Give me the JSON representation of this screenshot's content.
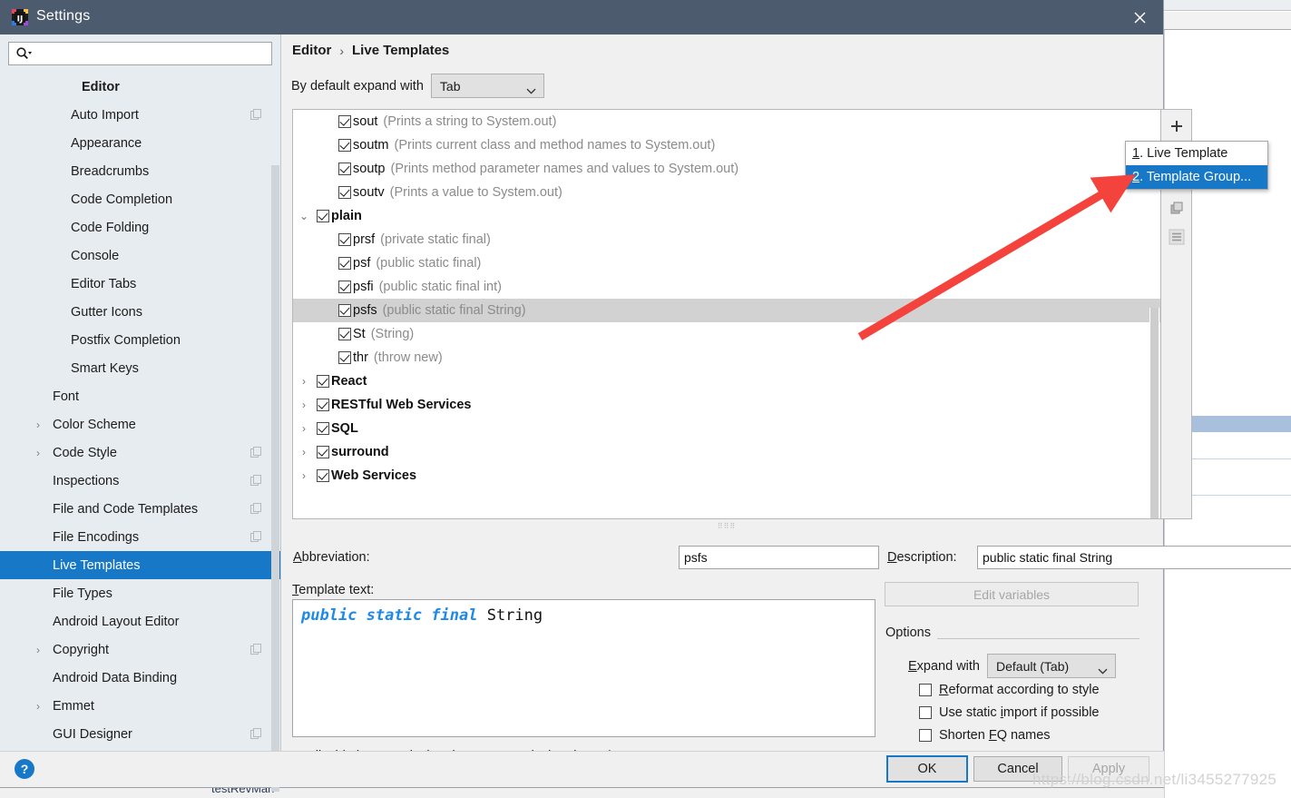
{
  "window": {
    "title": "Settings",
    "app_icon": "intellij-idea-logo-icon",
    "close_icon": "close-icon"
  },
  "sidebar": {
    "search": {
      "placeholder": "",
      "value": "",
      "icon": "search-icon"
    },
    "items": [
      {
        "label": "Editor",
        "level": 0,
        "bold": true,
        "arrow": "",
        "config_icon": false,
        "selected": false
      },
      {
        "label": "Auto Import",
        "level": 2,
        "bold": false,
        "arrow": "",
        "config_icon": true,
        "selected": false
      },
      {
        "label": "Appearance",
        "level": 2,
        "bold": false,
        "arrow": "",
        "config_icon": false,
        "selected": false
      },
      {
        "label": "Breadcrumbs",
        "level": 2,
        "bold": false,
        "arrow": "",
        "config_icon": false,
        "selected": false
      },
      {
        "label": "Code Completion",
        "level": 2,
        "bold": false,
        "arrow": "",
        "config_icon": false,
        "selected": false
      },
      {
        "label": "Code Folding",
        "level": 2,
        "bold": false,
        "arrow": "",
        "config_icon": false,
        "selected": false
      },
      {
        "label": "Console",
        "level": 2,
        "bold": false,
        "arrow": "",
        "config_icon": false,
        "selected": false
      },
      {
        "label": "Editor Tabs",
        "level": 2,
        "bold": false,
        "arrow": "",
        "config_icon": false,
        "selected": false
      },
      {
        "label": "Gutter Icons",
        "level": 2,
        "bold": false,
        "arrow": "",
        "config_icon": false,
        "selected": false
      },
      {
        "label": "Postfix Completion",
        "level": 2,
        "bold": false,
        "arrow": "",
        "config_icon": false,
        "selected": false
      },
      {
        "label": "Smart Keys",
        "level": 2,
        "bold": false,
        "arrow": "",
        "config_icon": false,
        "selected": false
      },
      {
        "label": "Font",
        "level": 1,
        "bold": false,
        "arrow": "",
        "config_icon": false,
        "selected": false
      },
      {
        "label": "Color Scheme",
        "level": 1,
        "bold": false,
        "arrow": "›",
        "config_icon": false,
        "selected": false
      },
      {
        "label": "Code Style",
        "level": 1,
        "bold": false,
        "arrow": "›",
        "config_icon": true,
        "selected": false
      },
      {
        "label": "Inspections",
        "level": 1,
        "bold": false,
        "arrow": "",
        "config_icon": true,
        "selected": false
      },
      {
        "label": "File and Code Templates",
        "level": 1,
        "bold": false,
        "arrow": "",
        "config_icon": true,
        "selected": false
      },
      {
        "label": "File Encodings",
        "level": 1,
        "bold": false,
        "arrow": "",
        "config_icon": true,
        "selected": false
      },
      {
        "label": "Live Templates",
        "level": 1,
        "bold": false,
        "arrow": "",
        "config_icon": false,
        "selected": true
      },
      {
        "label": "File Types",
        "level": 1,
        "bold": false,
        "arrow": "",
        "config_icon": false,
        "selected": false
      },
      {
        "label": "Android Layout Editor",
        "level": 1,
        "bold": false,
        "arrow": "",
        "config_icon": false,
        "selected": false
      },
      {
        "label": "Copyright",
        "level": 1,
        "bold": false,
        "arrow": "›",
        "config_icon": true,
        "selected": false
      },
      {
        "label": "Android Data Binding",
        "level": 1,
        "bold": false,
        "arrow": "",
        "config_icon": false,
        "selected": false
      },
      {
        "label": "Emmet",
        "level": 1,
        "bold": false,
        "arrow": "›",
        "config_icon": false,
        "selected": false
      },
      {
        "label": "GUI Designer",
        "level": 1,
        "bold": false,
        "arrow": "",
        "config_icon": true,
        "selected": false
      }
    ]
  },
  "main": {
    "breadcrumb": {
      "parent": "Editor",
      "separator": "›",
      "current": "Live Templates"
    },
    "expand_with": {
      "label": "By default expand with",
      "value": "Tab"
    },
    "templates": [
      {
        "indent": 2,
        "expander": "",
        "checked": true,
        "name": "sout",
        "group": false,
        "desc": "(Prints a string to System.out)",
        "selected": false
      },
      {
        "indent": 2,
        "expander": "",
        "checked": true,
        "name": "soutm",
        "group": false,
        "desc": "(Prints current class and method names to System.out)",
        "selected": false
      },
      {
        "indent": 2,
        "expander": "",
        "checked": true,
        "name": "soutp",
        "group": false,
        "desc": "(Prints method parameter names and values to System.out)",
        "selected": false
      },
      {
        "indent": 2,
        "expander": "",
        "checked": true,
        "name": "soutv",
        "group": false,
        "desc": "(Prints a value to System.out)",
        "selected": false
      },
      {
        "indent": 1,
        "expander": "⌄",
        "checked": true,
        "name": "plain",
        "group": true,
        "desc": "",
        "selected": false
      },
      {
        "indent": 2,
        "expander": "",
        "checked": true,
        "name": "prsf",
        "group": false,
        "desc": "(private static final)",
        "selected": false
      },
      {
        "indent": 2,
        "expander": "",
        "checked": true,
        "name": "psf",
        "group": false,
        "desc": "(public static final)",
        "selected": false
      },
      {
        "indent": 2,
        "expander": "",
        "checked": true,
        "name": "psfi",
        "group": false,
        "desc": "(public static final int)",
        "selected": false
      },
      {
        "indent": 2,
        "expander": "",
        "checked": true,
        "name": "psfs",
        "group": false,
        "desc": "(public static final String)",
        "selected": true
      },
      {
        "indent": 2,
        "expander": "",
        "checked": true,
        "name": "St",
        "group": false,
        "desc": "(String)",
        "selected": false
      },
      {
        "indent": 2,
        "expander": "",
        "checked": true,
        "name": "thr",
        "group": false,
        "desc": "(throw new)",
        "selected": false
      },
      {
        "indent": 1,
        "expander": "›",
        "checked": true,
        "name": "React",
        "group": true,
        "desc": "",
        "selected": false
      },
      {
        "indent": 1,
        "expander": "›",
        "checked": true,
        "name": "RESTful Web Services",
        "group": true,
        "desc": "",
        "selected": false
      },
      {
        "indent": 1,
        "expander": "›",
        "checked": true,
        "name": "SQL",
        "group": true,
        "desc": "",
        "selected": false
      },
      {
        "indent": 1,
        "expander": "›",
        "checked": true,
        "name": "surround",
        "group": true,
        "desc": "",
        "selected": false
      },
      {
        "indent": 1,
        "expander": "›",
        "checked": true,
        "name": "Web Services",
        "group": true,
        "desc": "",
        "selected": false
      }
    ],
    "toolbar": {
      "add_label": "+",
      "add_icon": "plus-icon",
      "copy_icon": "duplicate-icon",
      "list_icon": "list-icon"
    },
    "popup": {
      "items": [
        {
          "mnemonic": "1",
          "label": ". Live Template",
          "active": false
        },
        {
          "mnemonic": "2",
          "label": ". Template Group...",
          "active": true
        }
      ]
    },
    "splitter_dots": "⣿⣿⣿",
    "form": {
      "abbreviation_label_mnemonic": "A",
      "abbreviation_label_rest": "bbreviation:",
      "abbreviation_value": "psfs",
      "description_label_mnemonic": "D",
      "description_label_rest": "escription:",
      "description_value": "public static final String",
      "template_text_label_mnemonic": "T",
      "template_text_label_rest": "emplate text:",
      "template_code_keyword": "public static final",
      "template_code_rest": " String"
    },
    "applicable": {
      "text": "Applicable in Java: declaration; Groovy: declaration.",
      "link": "Change"
    },
    "options": {
      "edit_variables_label": "Edit variables",
      "legend": "Options",
      "expand_with_label_mnemonic": "E",
      "expand_with_label_rest": "xpand with",
      "expand_with_value": "Default (Tab)",
      "checkboxes": [
        {
          "mnemonic_pre": "R",
          "pre": "",
          "label_rest": "eformat according to style",
          "checked": false,
          "full": "Reformat according to style"
        },
        {
          "mnemonic_pre": "i",
          "pre": "Use static ",
          "label_rest": "mport if possible",
          "checked": false,
          "full": "Use static import if possible"
        },
        {
          "mnemonic_pre": "F",
          "pre": "Shorten ",
          "label_rest": "Q names",
          "checked": false,
          "full": "Shorten FQ names"
        }
      ]
    }
  },
  "bottom": {
    "help_label": "?",
    "ok_label": "OK",
    "cancel_label": "Cancel",
    "apply_label": "Apply"
  },
  "background": {
    "bottom_text": "testRevMan"
  },
  "watermark": "https://blog.csdn.net/li3455277925",
  "colors": {
    "titlebar": "#4d5b6e",
    "accent_blue": "#1878c8",
    "selection_gray": "#d2d2d2",
    "keyword_blue": "#1e8ae8",
    "link_blue": "#2a2ae0",
    "arrow_red": "#f4433c"
  }
}
